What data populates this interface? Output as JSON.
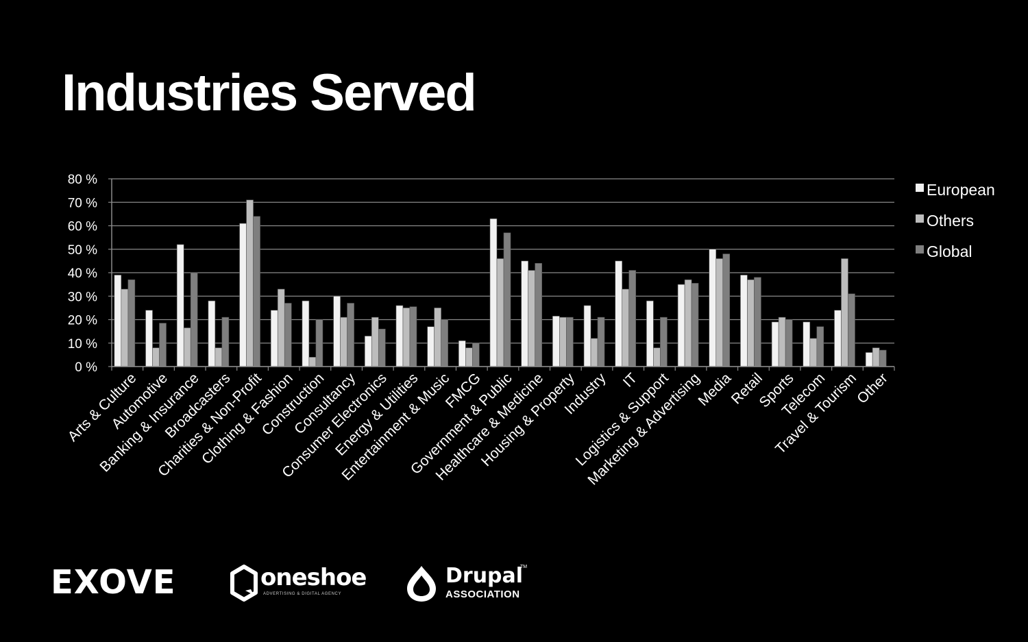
{
  "title": "Industries Served",
  "colors": {
    "background": "#000000",
    "grid": "#8a8a8a",
    "text": "#ffffff"
  },
  "chart_data": {
    "type": "bar",
    "title": "",
    "xlabel": "",
    "ylabel": "",
    "ylim": [
      0,
      80
    ],
    "y_ticks": [
      0,
      10,
      20,
      30,
      40,
      50,
      60,
      70,
      80
    ],
    "y_tick_labels": [
      "0 %",
      "10 %",
      "20 %",
      "30 %",
      "40 %",
      "50 %",
      "60 %",
      "70 %",
      "80 %"
    ],
    "grid": true,
    "legend_position": "right",
    "categories": [
      "Arts & Culture",
      "Automotive",
      "Banking & Insurance",
      "Broadcasters",
      "Charities & Non-Profit",
      "Clothing & Fashion",
      "Construction",
      "Consultancy",
      "Consumer Electronics",
      "Energy & Utilities",
      "Entertainment & Music",
      "FMCG",
      "Government & Public",
      "Healthcare & Medicine",
      "Housing & Property",
      "Industry",
      "IT",
      "Logistics & Support",
      "Marketing & Advertising",
      "Media",
      "Retail",
      "Sports",
      "Telecom",
      "Travel & Tourism",
      "Other"
    ],
    "series": [
      {
        "name": "European",
        "color": "#f2f2f2",
        "values": [
          39,
          24,
          52,
          28,
          61,
          24,
          28,
          30,
          13,
          26,
          17,
          11,
          63,
          45,
          21.5,
          26,
          45,
          28,
          35,
          50,
          39,
          19,
          19,
          24,
          6
        ]
      },
      {
        "name": "Others",
        "color": "#bdbdbd",
        "values": [
          33,
          8,
          16.5,
          8,
          71,
          33,
          4,
          21,
          21,
          25,
          25,
          8,
          46,
          41,
          21,
          12,
          33,
          8,
          37,
          46,
          37,
          21,
          12,
          46,
          8
        ]
      },
      {
        "name": "Global",
        "color": "#7f7f7f",
        "values": [
          37,
          18.5,
          40,
          21,
          64,
          27,
          20,
          27,
          16,
          25.5,
          20,
          10,
          57,
          44,
          21,
          21,
          41,
          21,
          35.5,
          48,
          38,
          20,
          17,
          31,
          7
        ]
      }
    ]
  },
  "logos": {
    "exove": "EXOVE",
    "oneshoe_name": "oneshoe",
    "oneshoe_tagline": "ADVERTISING & DIGITAL AGENCY",
    "drupal_name": "Drupal",
    "drupal_tm": "TM",
    "drupal_sub": "ASSOCIATION"
  }
}
